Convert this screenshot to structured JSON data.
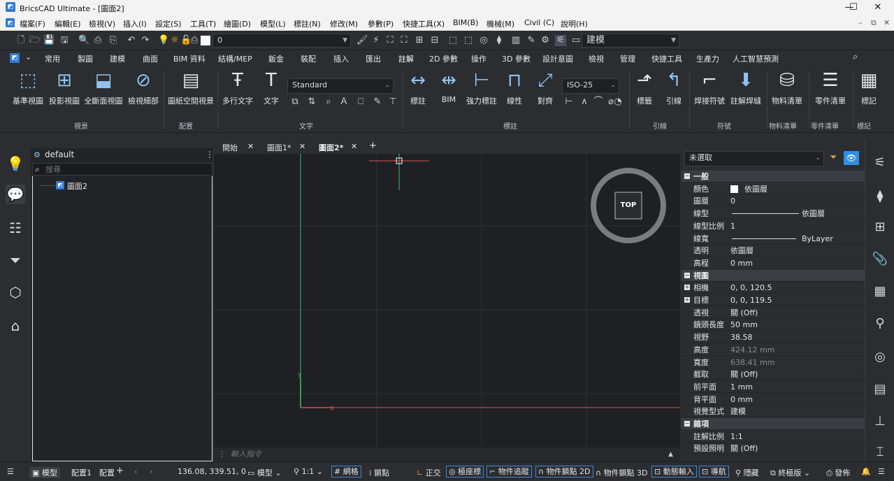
{
  "window": {
    "title": "BricsCAD Ultimate - [圖面2]"
  },
  "menu": [
    "檔案(F)",
    "編輯(E)",
    "檢視(V)",
    "插入(I)",
    "設定(S)",
    "工具(T)",
    "繪圖(D)",
    "模型(L)",
    "標註(N)",
    "修改(M)",
    "參數(P)",
    "快捷工具(X)",
    "BIM(B)",
    "機械(M)",
    "Civil (C)",
    "說明(H)"
  ],
  "toolbar": {
    "layer_value": "0",
    "workspace_value": "建模"
  },
  "ribbon_tabs": [
    "常用",
    "製圖",
    "建模",
    "曲面",
    "BIM 資料",
    "結構/MEP",
    "鈑金",
    "裝配",
    "插入",
    "匯出",
    "註解",
    "2D 參數",
    "操作",
    "3D 參數",
    "設計意圖",
    "檢視",
    "管理",
    "快捷工具",
    "生產力",
    "人工智慧預測"
  ],
  "ribbon": {
    "buttons": [
      "基準視圖",
      "投影視圖",
      "全斷面視圖",
      "檢視細部",
      "圖紙空間視景",
      "多行文字",
      "文字",
      "標註",
      "BIM",
      "強力標註",
      "線性",
      "對齊",
      "標籤",
      "引線",
      "焊接符號",
      "註解焊縫",
      "物料清單",
      "零件清單",
      "標記"
    ],
    "text_style": "Standard",
    "dim_style": "ISO-25",
    "groups": [
      "視景",
      "配置",
      "文字",
      "標註",
      "引線",
      "符號",
      "物料清單",
      "零件清單",
      "標記"
    ]
  },
  "left_panel": {
    "title": "default",
    "search_placeholder": "搜尋",
    "tree_item": "圖面2"
  },
  "doc_tabs": [
    "開始",
    "圖面1*",
    "圖面2*"
  ],
  "viewcube": "TOP",
  "command_placeholder": "輸入指令",
  "properties": {
    "selection": "未選取",
    "rows": [
      {
        "k": "一般",
        "sec": true
      },
      {
        "k": "顏色",
        "v": "依圖層"
      },
      {
        "k": "圖層",
        "v": "0"
      },
      {
        "k": "線型",
        "v": "依圖層"
      },
      {
        "k": "線型比例",
        "v": "1"
      },
      {
        "k": "線寬",
        "v": "ByLayer"
      },
      {
        "k": "透明",
        "v": "依圖層"
      },
      {
        "k": "高程",
        "v": "0 mm"
      },
      {
        "k": "視圖",
        "sec": true
      },
      {
        "k": "相機",
        "v": "0, 0, 120.5",
        "plus": true
      },
      {
        "k": "目標",
        "v": "0, 0, 119.5",
        "plus": true
      },
      {
        "k": "透視",
        "v": "關 (Off)"
      },
      {
        "k": "鏡頭長度",
        "v": "50 mm"
      },
      {
        "k": "視野",
        "v": "38.58"
      },
      {
        "k": "高度",
        "v": "424.12 mm",
        "dim": true
      },
      {
        "k": "寬度",
        "v": "638.41 mm",
        "dim": true
      },
      {
        "k": "截取",
        "v": "關 (Off)"
      },
      {
        "k": "前平面",
        "v": "1 mm"
      },
      {
        "k": "背平面",
        "v": "0 mm"
      },
      {
        "k": "視覺型式",
        "v": "建模"
      },
      {
        "k": "雜項",
        "sec": true
      },
      {
        "k": "註解比例",
        "v": "1:1"
      },
      {
        "k": "預設照明",
        "v": "關 (Off)"
      }
    ]
  },
  "status": {
    "tabs": [
      "模型",
      "配置1",
      "配置"
    ],
    "coords": "136.08, 339.51, 0",
    "space": "模型",
    "scale": "1:1",
    "toggles": [
      "網格",
      "鎖點",
      "正交",
      "極座標",
      "物件追蹤",
      "物件鎖點 2D",
      "物件鎖點 3D",
      "動態輸入",
      "導航",
      "隱藏",
      "終極版",
      "發佈"
    ]
  }
}
